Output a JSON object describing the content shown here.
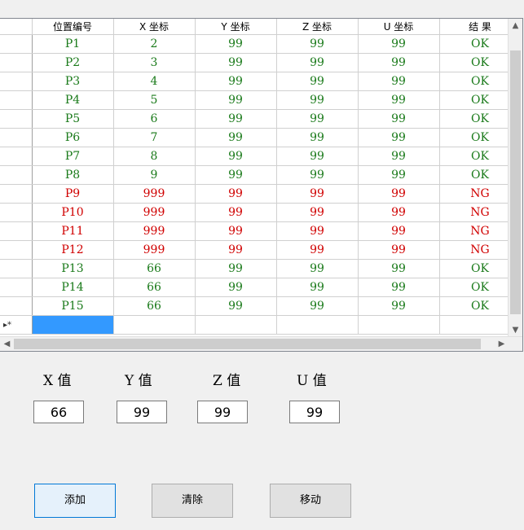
{
  "grid": {
    "headers": [
      "位置编号",
      "X 坐标",
      "Y 坐标",
      "Z 坐标",
      "U 坐标",
      "结 果"
    ],
    "rows": [
      {
        "id": "P1",
        "x": "2",
        "y": "99",
        "z": "99",
        "u": "99",
        "r": "OK"
      },
      {
        "id": "P2",
        "x": "3",
        "y": "99",
        "z": "99",
        "u": "99",
        "r": "OK"
      },
      {
        "id": "P3",
        "x": "4",
        "y": "99",
        "z": "99",
        "u": "99",
        "r": "OK"
      },
      {
        "id": "P4",
        "x": "5",
        "y": "99",
        "z": "99",
        "u": "99",
        "r": "OK"
      },
      {
        "id": "P5",
        "x": "6",
        "y": "99",
        "z": "99",
        "u": "99",
        "r": "OK"
      },
      {
        "id": "P6",
        "x": "7",
        "y": "99",
        "z": "99",
        "u": "99",
        "r": "OK"
      },
      {
        "id": "P7",
        "x": "8",
        "y": "99",
        "z": "99",
        "u": "99",
        "r": "OK"
      },
      {
        "id": "P8",
        "x": "9",
        "y": "99",
        "z": "99",
        "u": "99",
        "r": "OK"
      },
      {
        "id": "P9",
        "x": "999",
        "y": "99",
        "z": "99",
        "u": "99",
        "r": "NG"
      },
      {
        "id": "P10",
        "x": "999",
        "y": "99",
        "z": "99",
        "u": "99",
        "r": "NG"
      },
      {
        "id": "P11",
        "x": "999",
        "y": "99",
        "z": "99",
        "u": "99",
        "r": "NG"
      },
      {
        "id": "P12",
        "x": "999",
        "y": "99",
        "z": "99",
        "u": "99",
        "r": "NG"
      },
      {
        "id": "P13",
        "x": "66",
        "y": "99",
        "z": "99",
        "u": "99",
        "r": "OK"
      },
      {
        "id": "P14",
        "x": "66",
        "y": "99",
        "z": "99",
        "u": "99",
        "r": "OK"
      },
      {
        "id": "P15",
        "x": "66",
        "y": "99",
        "z": "99",
        "u": "99",
        "r": "OK"
      }
    ],
    "new_row_marker": "▸*",
    "colors": {
      "ok": "#1a7a1a",
      "ng": "#d00000",
      "selected": "#3399ff"
    }
  },
  "inputs": {
    "x_label": "X 值",
    "x_value": "66",
    "y_label": "Y 值",
    "y_value": "99",
    "z_label": "Z 值",
    "z_value": "99",
    "u_label": "U 值",
    "u_value": "99"
  },
  "buttons": {
    "add": "添加",
    "clear": "清除",
    "move": "移动"
  },
  "icons": {
    "scroll_up": "▲",
    "scroll_down": "▼",
    "scroll_left": "◀",
    "scroll_right": "▶"
  }
}
